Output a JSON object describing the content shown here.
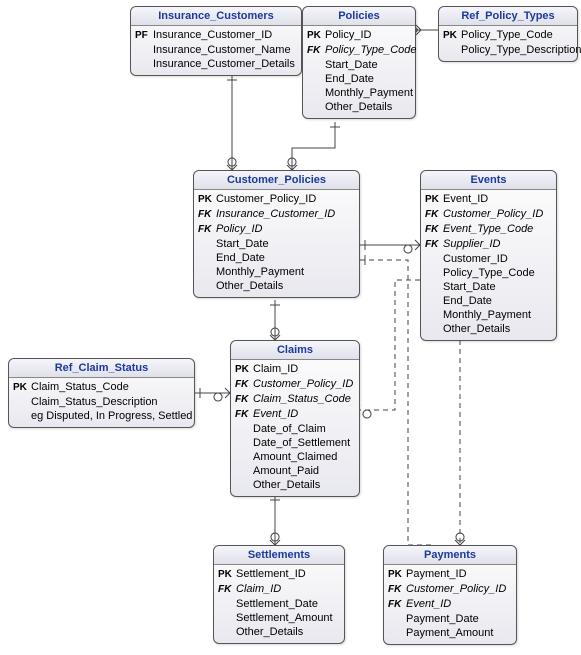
{
  "entities": {
    "insurance_customers": {
      "title": "Insurance_Customers",
      "rows": [
        {
          "key": "PF",
          "name": "Insurance_Customer_ID"
        },
        {
          "key": "",
          "name": "Insurance_Customer_Name"
        },
        {
          "key": "",
          "name": "Insurance_Customer_Details"
        }
      ]
    },
    "policies": {
      "title": "Policies",
      "rows": [
        {
          "key": "PK",
          "name": "Policy_ID"
        },
        {
          "key": "FK",
          "name": "Policy_Type_Code",
          "fk": true
        },
        {
          "key": "",
          "name": "Start_Date"
        },
        {
          "key": "",
          "name": "End_Date"
        },
        {
          "key": "",
          "name": "Monthly_Payment"
        },
        {
          "key": "",
          "name": "Other_Details"
        }
      ]
    },
    "ref_policy_types": {
      "title": "Ref_Policy_Types",
      "rows": [
        {
          "key": "PK",
          "name": "Policy_Type_Code"
        },
        {
          "key": "",
          "name": "Policy_Type_Description"
        }
      ]
    },
    "customer_policies": {
      "title": "Customer_Policies",
      "rows": [
        {
          "key": "PK",
          "name": "Customer_Policy_ID"
        },
        {
          "key": "FK",
          "name": "Insurance_Customer_ID",
          "fk": true
        },
        {
          "key": "FK",
          "name": "Policy_ID",
          "fk": true
        },
        {
          "key": "",
          "name": "Start_Date"
        },
        {
          "key": "",
          "name": "End_Date"
        },
        {
          "key": "",
          "name": "Monthly_Payment"
        },
        {
          "key": "",
          "name": "Other_Details"
        }
      ]
    },
    "events": {
      "title": "Events",
      "rows": [
        {
          "key": "PK",
          "name": "Event_ID"
        },
        {
          "key": "FK",
          "name": "Customer_Policy_ID",
          "fk": true
        },
        {
          "key": "FK",
          "name": "Event_Type_Code",
          "fk": true
        },
        {
          "key": "FK",
          "name": "Supplier_ID",
          "fk": true
        },
        {
          "key": "",
          "name": "Customer_ID"
        },
        {
          "key": "",
          "name": "Policy_Type_Code"
        },
        {
          "key": "",
          "name": "Start_Date"
        },
        {
          "key": "",
          "name": "End_Date"
        },
        {
          "key": "",
          "name": "Monthly_Payment"
        },
        {
          "key": "",
          "name": "Other_Details"
        }
      ]
    },
    "ref_claim_status": {
      "title": "Ref_Claim_Status",
      "rows": [
        {
          "key": "PK",
          "name": "Claim_Status_Code"
        },
        {
          "key": "",
          "name": "Claim_Status_Description"
        },
        {
          "key": "",
          "name": "eg Disputed, In Progress, Settled"
        }
      ]
    },
    "claims": {
      "title": "Claims",
      "rows": [
        {
          "key": "PK",
          "name": "Claim_ID"
        },
        {
          "key": "FK",
          "name": "Customer_Policy_ID",
          "fk": true
        },
        {
          "key": "FK",
          "name": "Claim_Status_Code",
          "fk": true
        },
        {
          "key": "FK",
          "name": "Event_ID",
          "fk": true
        },
        {
          "key": "",
          "name": "Date_of_Claim"
        },
        {
          "key": "",
          "name": "Date_of_Settlement"
        },
        {
          "key": "",
          "name": "Amount_Claimed"
        },
        {
          "key": "",
          "name": "Amount_Paid"
        },
        {
          "key": "",
          "name": "Other_Details"
        }
      ]
    },
    "settlements": {
      "title": "Settlements",
      "rows": [
        {
          "key": "PK",
          "name": "Settlement_ID"
        },
        {
          "key": "FK",
          "name": "Claim_ID",
          "fk": true
        },
        {
          "key": "",
          "name": "Settlement_Date"
        },
        {
          "key": "",
          "name": "Settlement_Amount"
        },
        {
          "key": "",
          "name": "Other_Details"
        }
      ]
    },
    "payments": {
      "title": "Payments",
      "rows": [
        {
          "key": "PK",
          "name": "Payment_ID"
        },
        {
          "key": "FK",
          "name": "Customer_Policy_ID",
          "fk": true
        },
        {
          "key": "FK",
          "name": "Event_ID",
          "fk": true
        },
        {
          "key": "",
          "name": "Payment_Date"
        },
        {
          "key": "",
          "name": "Payment_Amount"
        }
      ]
    }
  }
}
